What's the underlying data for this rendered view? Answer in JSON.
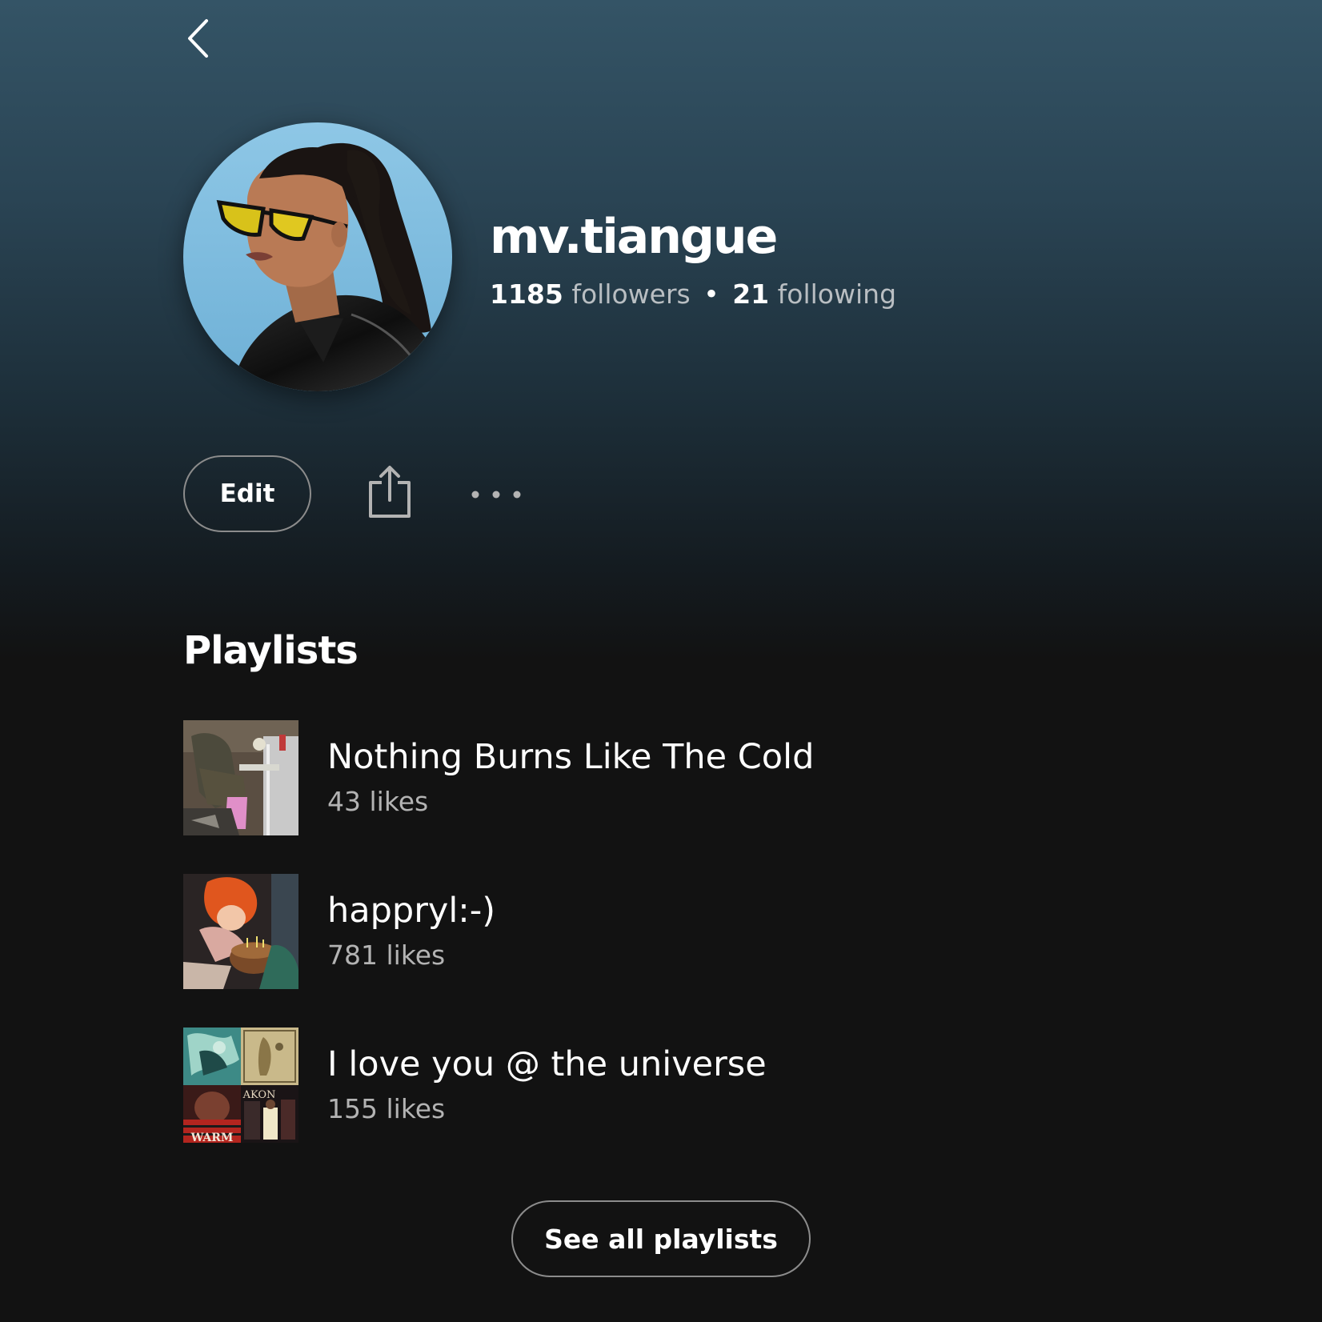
{
  "profile": {
    "name": "mv.tiangue",
    "followers_count": "1185",
    "followers_label": "followers",
    "separator": "•",
    "following_count": "21",
    "following_label": "following"
  },
  "actions": {
    "edit_label": "Edit",
    "back_icon": "chevron-left-icon",
    "share_icon": "share-icon",
    "more_icon": "more-horizontal-icon"
  },
  "playlists": {
    "heading": "Playlists",
    "items": [
      {
        "title": "Nothing Burns Like The Cold",
        "likes": "43 likes"
      },
      {
        "title": "happryl:-)",
        "likes": "781 likes"
      },
      {
        "title": "I love you @ the universe",
        "likes": "155 likes"
      }
    ],
    "see_all_label": "See all playlists",
    "cover_mosaic_text": [
      "WARM",
      "AKON"
    ]
  },
  "colors": {
    "background": "#121212",
    "header_gradient_top": "#345466",
    "text_primary": "#ffffff",
    "text_secondary": "#b3b3b3",
    "button_border": "#8c8c8c"
  }
}
